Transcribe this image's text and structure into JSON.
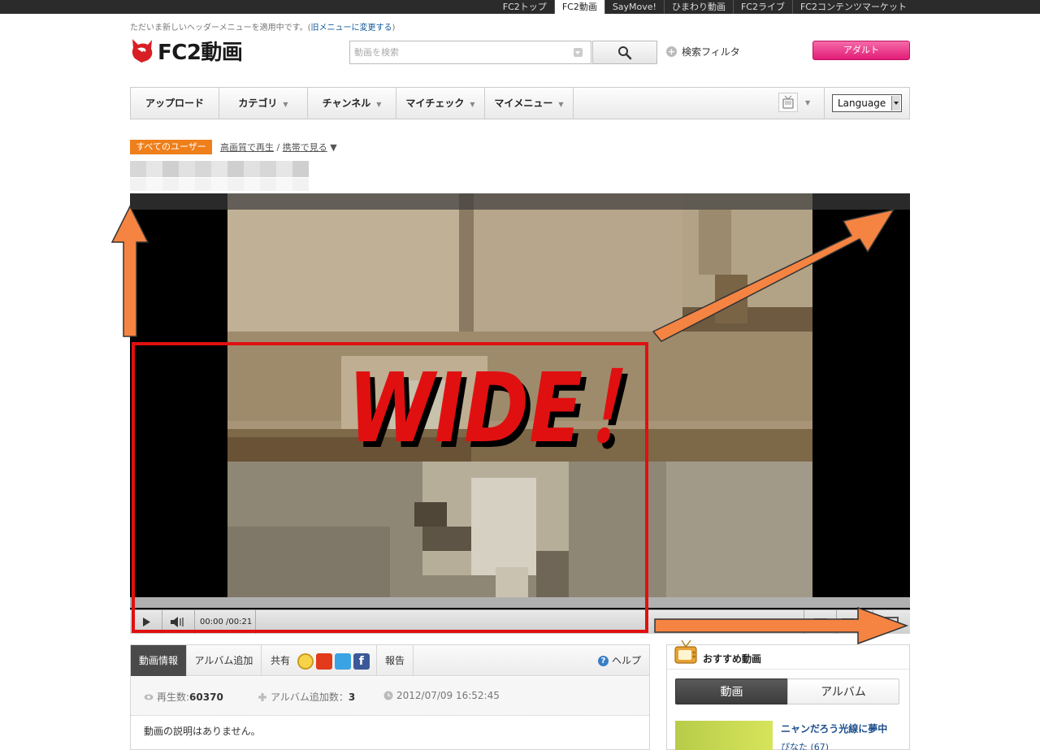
{
  "topbar": {
    "links": [
      "FC2トップ",
      "FC2動画",
      "SayMove!",
      "ひまわり動画",
      "FC2ライブ",
      "FC2コンテンツマーケット"
    ],
    "active_index": 1
  },
  "notice": {
    "text": "ただいま新しいヘッダーメニューを適用中です。(",
    "link": "旧メニューに変更する",
    "tail": ")"
  },
  "logo": {
    "text": "FC2動画"
  },
  "search": {
    "placeholder": "動画を検索",
    "filter_label": "検索フィルタ"
  },
  "adult_button": "アダルト",
  "nav": {
    "items": [
      {
        "label": "アップロード",
        "has_caret": false
      },
      {
        "label": "カテゴリ",
        "has_caret": true
      },
      {
        "label": "チャンネル",
        "has_caret": true
      },
      {
        "label": "マイチェック",
        "has_caret": true
      },
      {
        "label": "マイメニュー",
        "has_caret": true
      }
    ],
    "caret": "▼",
    "language": "Language"
  },
  "meta": {
    "badge": "すべてのユーザー",
    "hq_link": "高画質で再生",
    "separator": "/",
    "mobile_link": "携帯で見る",
    "mobile_caret": "▼"
  },
  "player": {
    "time": "00:00 /00:21",
    "progress_fraction": 0.0
  },
  "annotation": {
    "text": "WIDE！",
    "color": "#e01010",
    "arrow_color": "#f58442"
  },
  "info": {
    "tabs": [
      "動画情報",
      "アルバム追加",
      "共有",
      "報告"
    ],
    "help": "ヘルプ",
    "play_count_label": "再生数:",
    "play_count": "60370",
    "album_label": "アルバム追加数：",
    "album_count": "3",
    "date": "2012/07/09 16:52:45",
    "description": "動画の説明はありません。"
  },
  "recommend": {
    "title": "おすすめ動画",
    "tab_video": "動画",
    "tab_album": "アルバム",
    "item_title": "ニャンだろう光線に夢中",
    "item_user": "ぴなた (67)"
  }
}
